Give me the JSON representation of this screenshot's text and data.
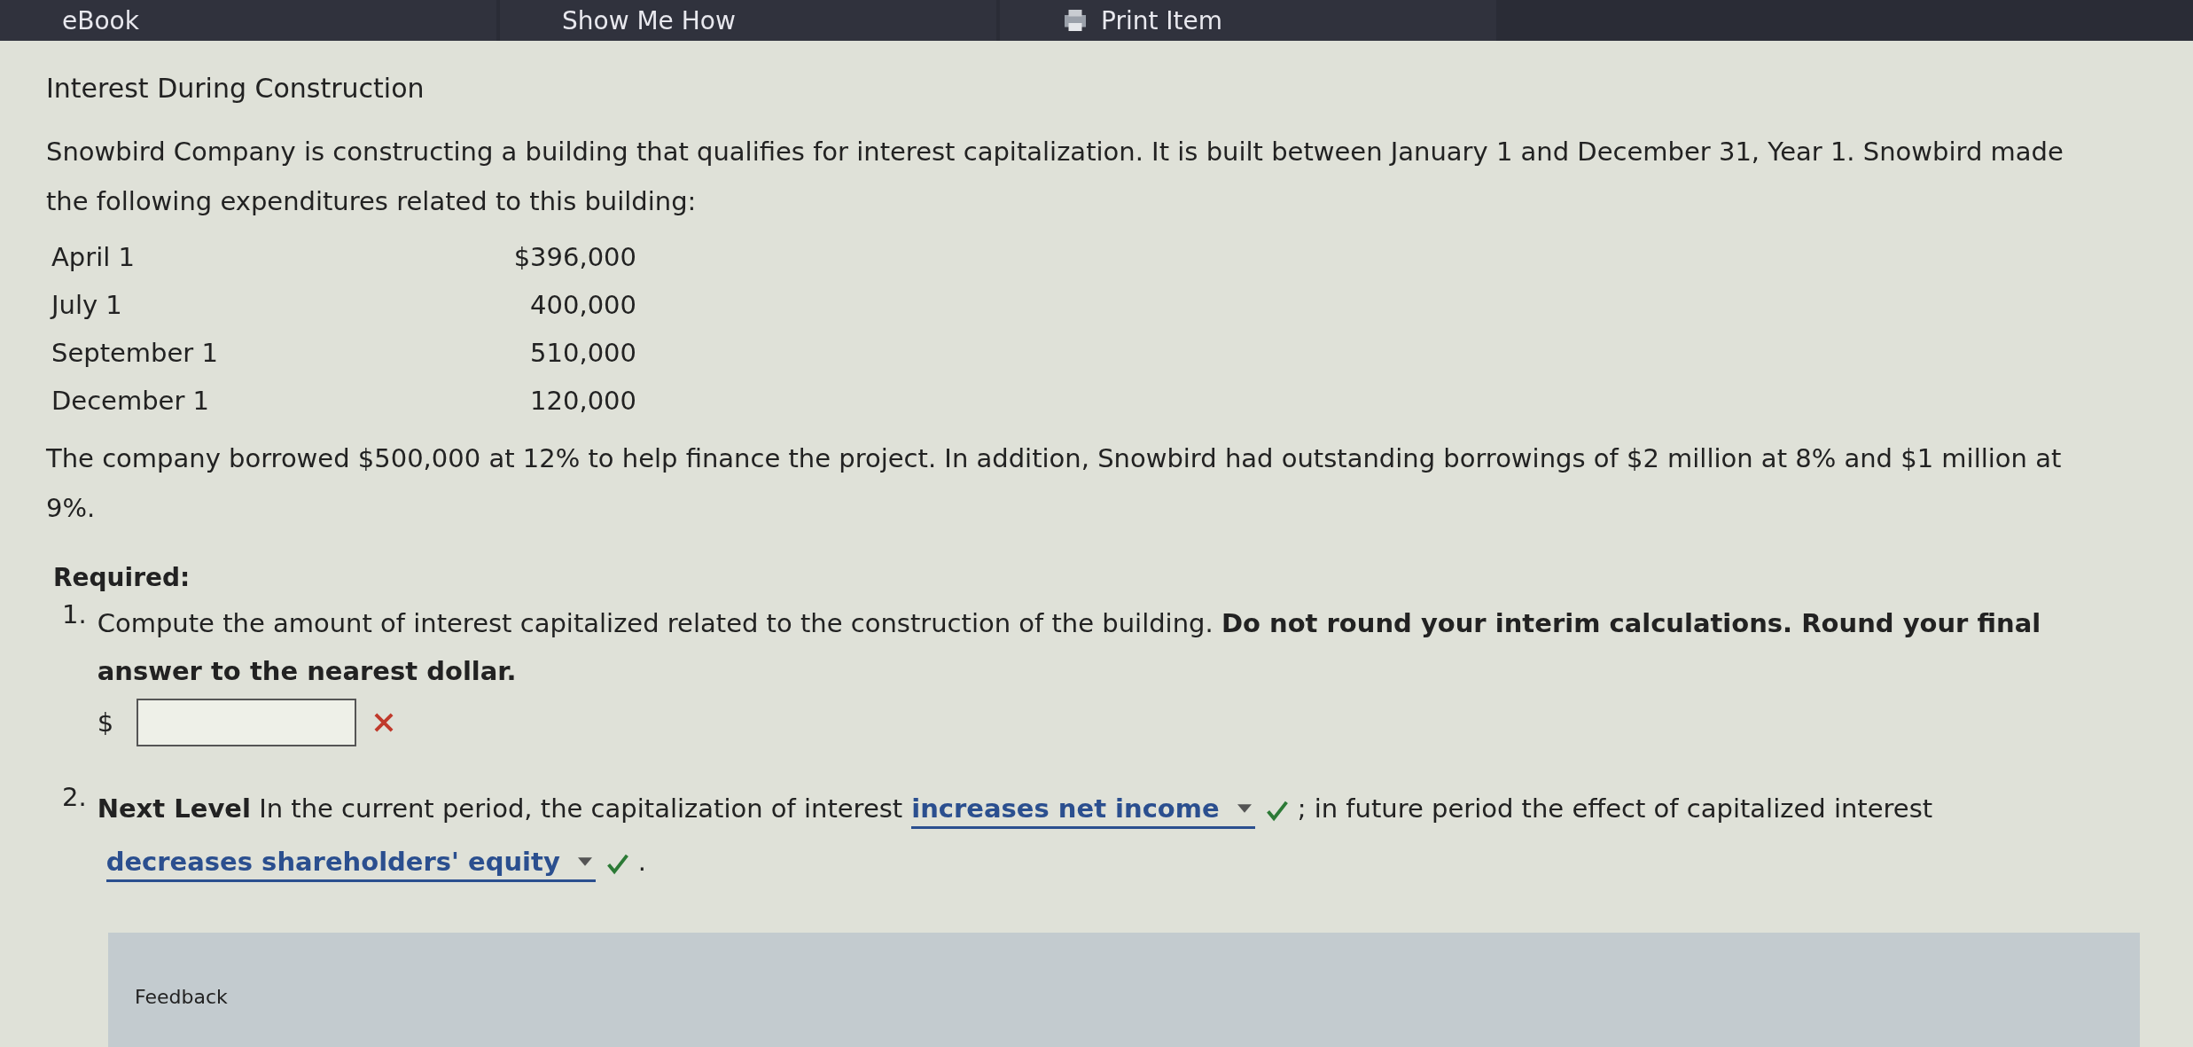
{
  "tabs": [
    {
      "label": "eBook",
      "kind": "text"
    },
    {
      "label": "Show Me How",
      "kind": "text"
    },
    {
      "label": "Print Item",
      "kind": "print"
    }
  ],
  "title": "Interest During Construction",
  "intro": "Snowbird Company is constructing a building that qualifies for interest capitalization. It is built between January 1 and December 31, Year 1. Snowbird made the following expenditures related to this building:",
  "expenditures": [
    {
      "date": "April 1",
      "amount": "$396,000"
    },
    {
      "date": "July 1",
      "amount": "400,000"
    },
    {
      "date": "September 1",
      "amount": "510,000"
    },
    {
      "date": "December 1",
      "amount": "120,000"
    }
  ],
  "borrowing_text": "The company borrowed $500,000 at 12% to help finance the project. In addition, Snowbird had outstanding borrowings of $2 million at 8% and $1 million at 9%.",
  "required_label": "Required:",
  "questions": [
    {
      "number": "1.",
      "text": "Compute the amount of interest capitalized related to the construction of the building. **Do not round your interim calculations. Round your final answer to the nearest dollar.**",
      "answer": {
        "prefix": "$",
        "correct": false
      }
    },
    {
      "number": "2.",
      "parts": [
        {
          "kind": "text",
          "text": "**Next Level** In the current period, the capitalization of interest"
        },
        {
          "kind": "select",
          "value": "increases net income",
          "correct": true
        },
        {
          "kind": "text",
          "text": "; in future period the effect of capitalized interest"
        },
        {
          "kind": "select",
          "value": "decreases shareholders' equity",
          "correct": true
        },
        {
          "kind": "text",
          "text": "."
        }
      ]
    }
  ],
  "feedback_label": "Feedback"
}
